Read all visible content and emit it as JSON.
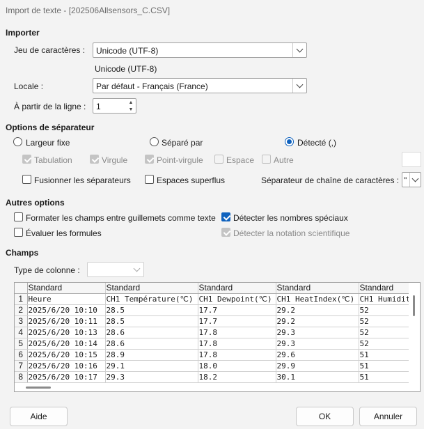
{
  "window": {
    "title": "Import de texte - [202506Allsensors_C.CSV]"
  },
  "import": {
    "section": "Importer",
    "charset_label": "Jeu de caractères :",
    "charset_value": "Unicode (UTF-8)",
    "charset_preview": "Unicode (UTF-8)",
    "locale_label": "Locale :",
    "locale_value": "Par défaut - Français (France)",
    "from_row_label": "À partir de la ligne :",
    "from_row_value": "1"
  },
  "separator": {
    "section": "Options de séparateur",
    "fixed_width": "Largeur fixe",
    "separated_by": "Séparé par",
    "detected": "Détecté (,)",
    "tab": "Tabulation",
    "comma": "Virgule",
    "semicolon": "Point-virgule",
    "space": "Espace",
    "other": "Autre",
    "merge": "Fusionner les séparateurs",
    "trim": "Espaces superflus",
    "string_delim_label": "Séparateur de chaîne de caractères :",
    "string_delim_value": "\""
  },
  "other_options": {
    "section": "Autres options",
    "quoted_as_text": "Formater les champs entre guillemets comme texte",
    "detect_special": "Détecter les nombres spéciaux",
    "eval_formulas": "Évaluer les formules",
    "detect_scientific": "Détecter la notation scientifique"
  },
  "fields": {
    "section": "Champs",
    "column_type_label": "Type de colonne :",
    "column_type_value": "",
    "col_types": [
      "Standard",
      "Standard",
      "Standard",
      "Standard",
      "Standard"
    ],
    "row_numbers": [
      "1",
      "2",
      "3",
      "4",
      "5",
      "6",
      "7",
      "8"
    ],
    "rows": [
      [
        "Heure",
        "CH1 Température(℃)",
        "CH1 Dewpoint(℃)",
        "CH1 HeatIndex(℃)",
        "CH1 Humidit"
      ],
      [
        "2025/6/20 10:10",
        "28.5",
        "17.7",
        "29.2",
        "52"
      ],
      [
        "2025/6/20 10:11",
        "28.5",
        "17.7",
        "29.2",
        "52"
      ],
      [
        "2025/6/20 10:13",
        "28.6",
        "17.8",
        "29.3",
        "52"
      ],
      [
        "2025/6/20 10:14",
        "28.6",
        "17.8",
        "29.3",
        "52"
      ],
      [
        "2025/6/20 10:15",
        "28.9",
        "17.8",
        "29.6",
        "51"
      ],
      [
        "2025/6/20 10:16",
        "29.1",
        "18.0",
        "29.9",
        "51"
      ],
      [
        "2025/6/20 10:17",
        "29.3",
        "18.2",
        "30.1",
        "51"
      ]
    ]
  },
  "buttons": {
    "help": "Aide",
    "ok": "OK",
    "cancel": "Annuler"
  }
}
